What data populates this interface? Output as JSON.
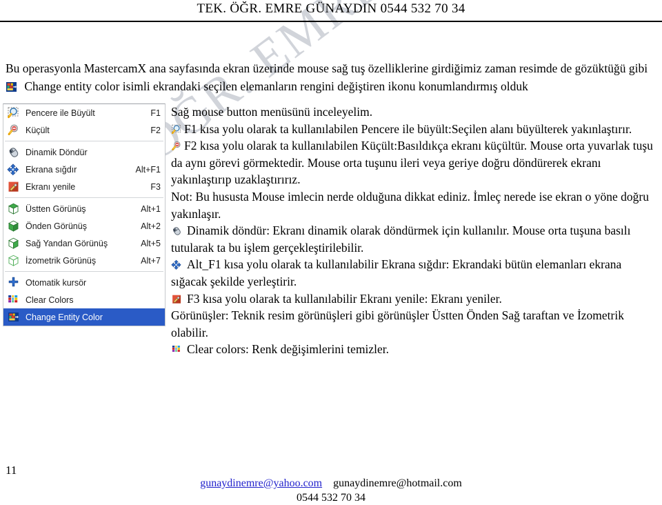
{
  "header": {
    "title": "TEK. ÖĞR. EMRE GÜNAYDIN  0544 532 70 34"
  },
  "watermark": {
    "text": "TEK. ÖĞR. EMRE GÜNAYDIN"
  },
  "intro": {
    "line1": "Bu operasyonla MastercamX ana sayfasında ekran üzerinde mouse sağ tuş özelliklerine girdiğimiz zaman resimde de gözüktüğü gibi",
    "line2": "Change entity color isimli ekrandaki seçilen elemanların rengini değiştiren ikonu konumlandırmış olduk",
    "icon": "change-entity-color-icon"
  },
  "context_menu": {
    "selected_color": "#2a5bc6",
    "groups": [
      {
        "items": [
          {
            "icon": "zoom-window-icon",
            "label": "Pencere ile Büyült",
            "shortcut": "F1",
            "selected": false
          },
          {
            "icon": "zoom-out-icon",
            "label": "Küçült",
            "shortcut": "F2",
            "selected": false
          }
        ]
      },
      {
        "items": [
          {
            "icon": "dynamic-rotate-mouse-icon",
            "label": "Dinamik Döndür",
            "shortcut": "",
            "selected": false
          },
          {
            "icon": "fit-to-screen-icon",
            "label": "Ekrana sığdır",
            "shortcut": "Alt+F1",
            "selected": false
          },
          {
            "icon": "refresh-screen-icon",
            "label": "Ekranı yenile",
            "shortcut": "F3",
            "selected": false
          }
        ]
      },
      {
        "items": [
          {
            "icon": "top-view-cube-icon",
            "label": "Üstten Görünüş",
            "shortcut": "Alt+1",
            "selected": false
          },
          {
            "icon": "front-view-cube-icon",
            "label": "Önden Görünüş",
            "shortcut": "Alt+2",
            "selected": false
          },
          {
            "icon": "right-view-cube-icon",
            "label": "Sağ Yandan Görünüş",
            "shortcut": "Alt+5",
            "selected": false
          },
          {
            "icon": "isometric-view-cube-icon",
            "label": "İzometrik Görünüş",
            "shortcut": "Alt+7",
            "selected": false
          }
        ]
      },
      {
        "items": [
          {
            "icon": "auto-cursor-icon",
            "label": "Otomatik kursör",
            "shortcut": "",
            "selected": false
          },
          {
            "icon": "clear-colors-icon",
            "label": "Clear Colors",
            "shortcut": "",
            "selected": false
          },
          {
            "icon": "change-entity-color-icon",
            "label": "Change Entity Color",
            "shortcut": "",
            "selected": true
          }
        ]
      }
    ]
  },
  "body": {
    "p0": "Sağ mouse button menüsünü inceleyelim.",
    "p1": "F1 kısa yolu olarak ta kullanılabilen Pencere ile büyült:Seçilen alanı büyülterek yakınlaştırır.",
    "p2": "F2 kısa yolu olarak ta kullanılabilen Küçült:Basıldıkça ekranı küçültür. Mouse orta yuvarlak tuşu da aynı görevi görmektedir. Mouse orta tuşunu ileri veya geriye doğru döndürerek ekranı yakınlaştırıp uzaklaştırırız.",
    "p3": "Not: Bu hususta Mouse imlecin nerde olduğuna dikkat ediniz. İmleç nerede ise ekran o yöne doğru yakınlaşır.",
    "p4": "Dinamik döndür: Ekranı dinamik olarak döndürmek için kullanılır. Mouse orta tuşuna basılı tutularak ta bu işlem gerçekleştirilebilir.",
    "p5": "Alt_F1 kısa yolu olarak ta kullanılabilir Ekrana sığdır: Ekrandaki bütün elemanları ekrana sığacak şekilde yerleştirir.",
    "p6": "F3 kısa yolu olarak ta kullanılabilir Ekranı yenile: Ekranı yeniler.",
    "p7": "Görünüşler: Teknik resim görünüşleri gibi görünüşler Üstten Önden Sağ taraftan ve İzometrik olabilir.",
    "p8": "Clear colors: Renk değişimlerini temizler."
  },
  "page_number": "11",
  "footer": {
    "email_link": "gunaydinemre@yahoo.com",
    "email_plain": "gunaydinemre@hotmail.com",
    "phone": "0544 532 70 34"
  }
}
